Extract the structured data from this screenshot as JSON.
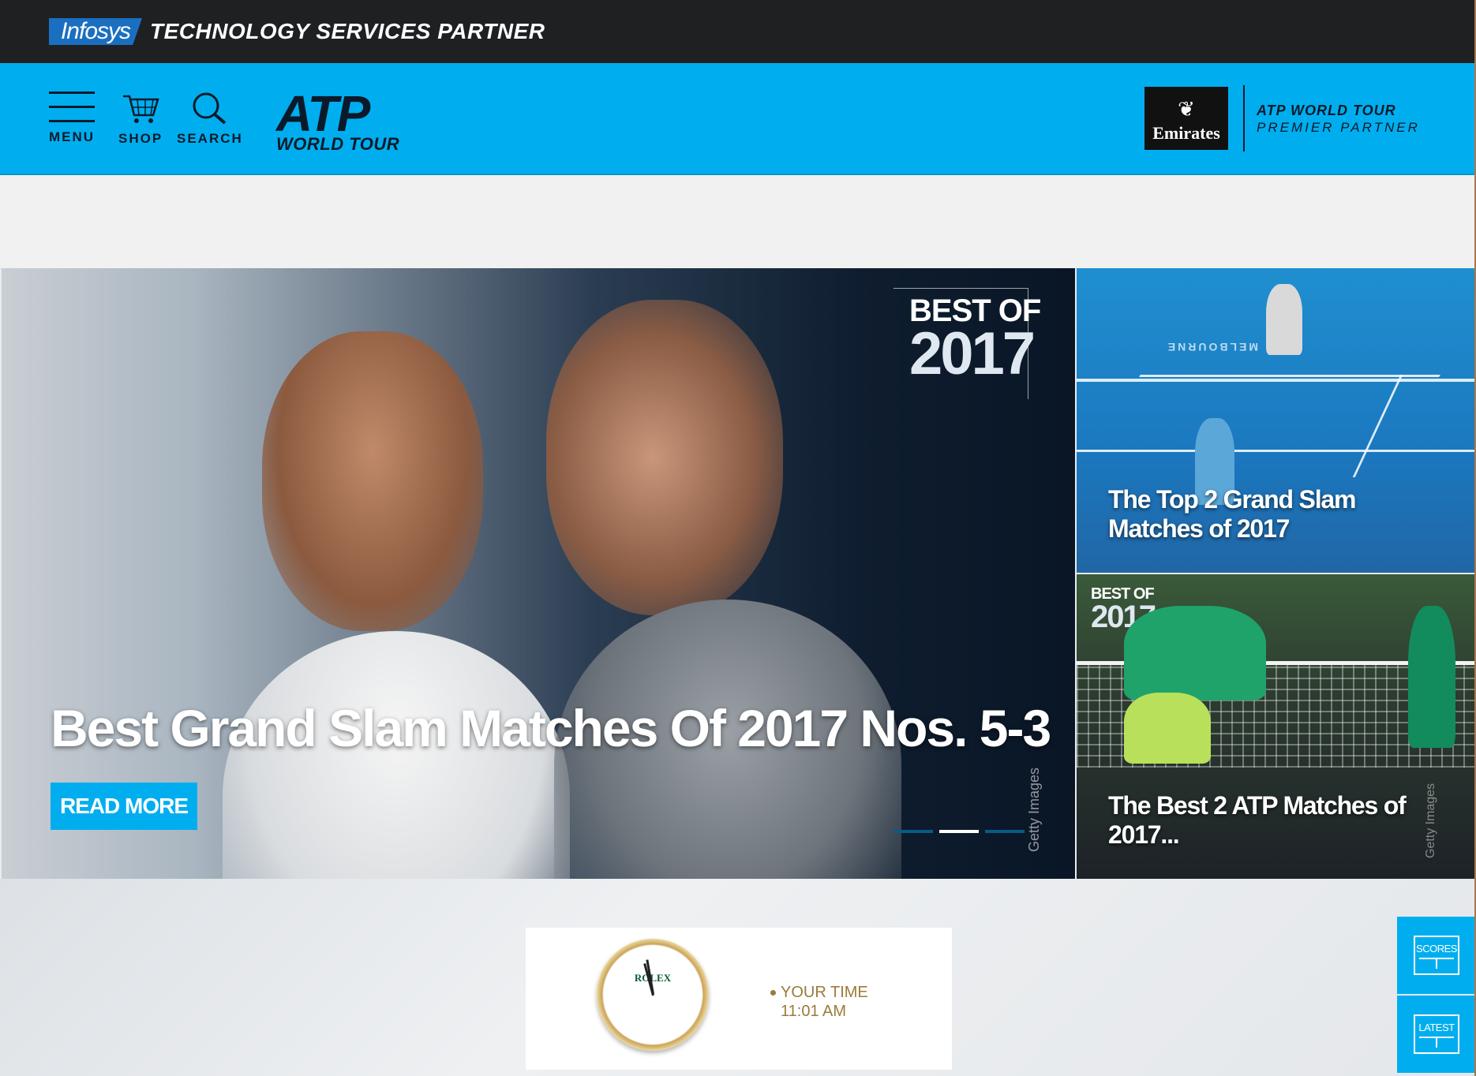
{
  "sponsor_bar": {
    "logo_text": "Infosys",
    "tagline": "TECHNOLOGY SERVICES PARTNER"
  },
  "header": {
    "menu_label": "MENU",
    "shop_label": "SHOP",
    "search_label": "SEARCH",
    "logo_main": "ATP",
    "logo_sub": "WORLD TOUR",
    "partner_brand": "Emirates",
    "partner_line1": "ATP WORLD TOUR",
    "partner_line2": "PREMIER PARTNER"
  },
  "hero": {
    "badge_line1": "BEST OF",
    "badge_line2": "2017",
    "title": "Best Grand Slam Matches Of 2017 Nos. 5-3",
    "cta": "READ MORE",
    "credit": "Getty Images",
    "slides_total": 3,
    "active_slide": 2
  },
  "side_cards": [
    {
      "title": "The Top 2 Grand Slam Matches of 2017",
      "court_text": "MELBOURNE"
    },
    {
      "badge_line1": "BEST OF",
      "badge_line2": "2017",
      "title": "The Best 2 ATP Matches of 2017...",
      "credit": "Getty Images"
    }
  ],
  "rolex_ad": {
    "brand": "ROLEX",
    "label": "YOUR TIME",
    "time": "11:01 AM"
  },
  "floating": {
    "scores_label": "SCORES",
    "latest_label": "LATEST"
  },
  "colors": {
    "accent": "#00aeef",
    "top_bar": "#1f2022",
    "dark_text": "#0a1a2a"
  }
}
